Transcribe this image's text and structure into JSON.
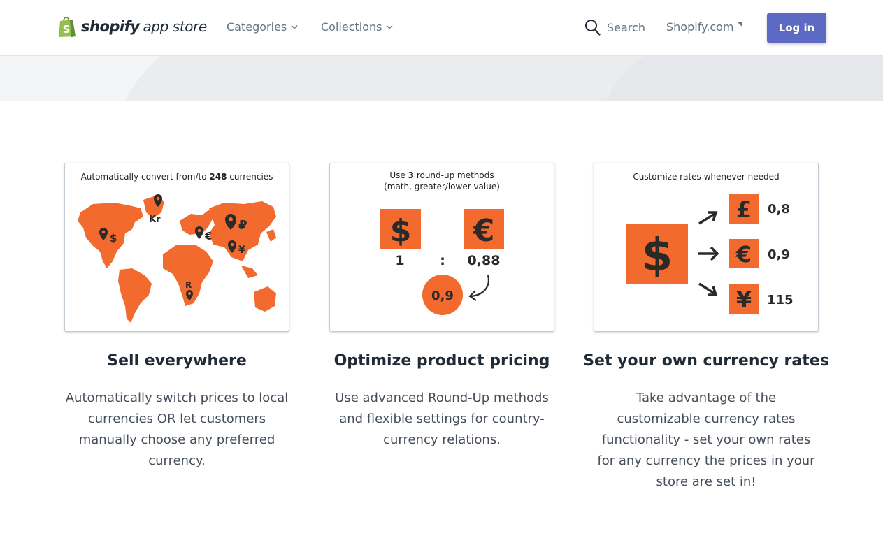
{
  "header": {
    "logo_text": "shopify",
    "logo_sub": "app store",
    "nav": [
      {
        "label": "Categories",
        "icon": "chevron-down-icon"
      },
      {
        "label": "Collections",
        "icon": "chevron-down-icon"
      }
    ],
    "search_label": "Search",
    "shopify_link": "Shopify.com",
    "login_label": "Log in"
  },
  "colors": {
    "accent": "#5c6ac4",
    "orange": "#f26a2e",
    "logo_green": "#95bf47"
  },
  "features": [
    {
      "image_caption_prefix": "Automatically convert from/to",
      "image_caption_bold": "248",
      "image_caption_suffix": "currencies",
      "map_symbols": [
        "Kr",
        "$",
        "€",
        "₽",
        "¥",
        "R"
      ],
      "title": "Sell everywhere",
      "description": "Automatically switch prices to local currencies OR let customers manually choose any preferred currency."
    },
    {
      "image_caption_line1_prefix": "Use",
      "image_caption_line1_bold": "3",
      "image_caption_line1_suffix": "round-up methods",
      "image_caption_line2": "(math, greater/lower value)",
      "from_symbol": "$",
      "to_symbol": "€",
      "from_value": "1",
      "separator": ":",
      "to_value": "0,88",
      "rounded_value": "0,9",
      "title": "Optimize product pricing",
      "description": "Use advanced Round-Up methods and flexible settings for country-currency relations."
    },
    {
      "image_caption": "Customize rates whenever needed",
      "base_symbol": "$",
      "rates": [
        {
          "symbol": "£",
          "value": "0,8"
        },
        {
          "symbol": "€",
          "value": "0,9"
        },
        {
          "symbol": "¥",
          "value": "115"
        }
      ],
      "title": "Set your own currency rates",
      "description": "Take advantage of the customizable currency rates functionality - set your own rates for any currency the prices in your store are set in!"
    }
  ]
}
